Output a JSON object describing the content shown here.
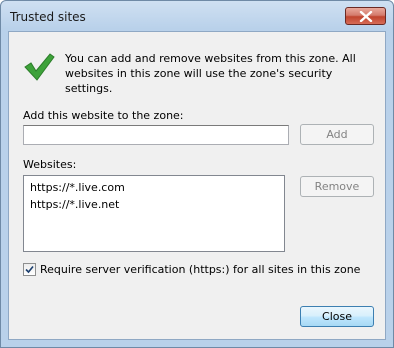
{
  "window": {
    "title": "Trusted sites"
  },
  "info": {
    "text": "You can add and remove websites from this zone. All websites in this zone will use the zone's security settings."
  },
  "add_site": {
    "label": "Add this website to the zone:",
    "value": "",
    "button": "Add"
  },
  "websites": {
    "label": "Websites:",
    "items": [
      "https://*.live.com",
      "https://*.live.net"
    ],
    "remove_button": "Remove"
  },
  "verification": {
    "label": "Require server verification (https:) for all sites in this zone",
    "checked": true
  },
  "footer": {
    "close_button": "Close"
  },
  "icons": {
    "info": "green-checkmark-icon",
    "title_close": "close-x-icon",
    "checkbox": "checkmark-icon"
  },
  "colors": {
    "client_bg": "#f0f0f0",
    "title_close": "#c0442e",
    "checkmark": "#3da23a"
  }
}
